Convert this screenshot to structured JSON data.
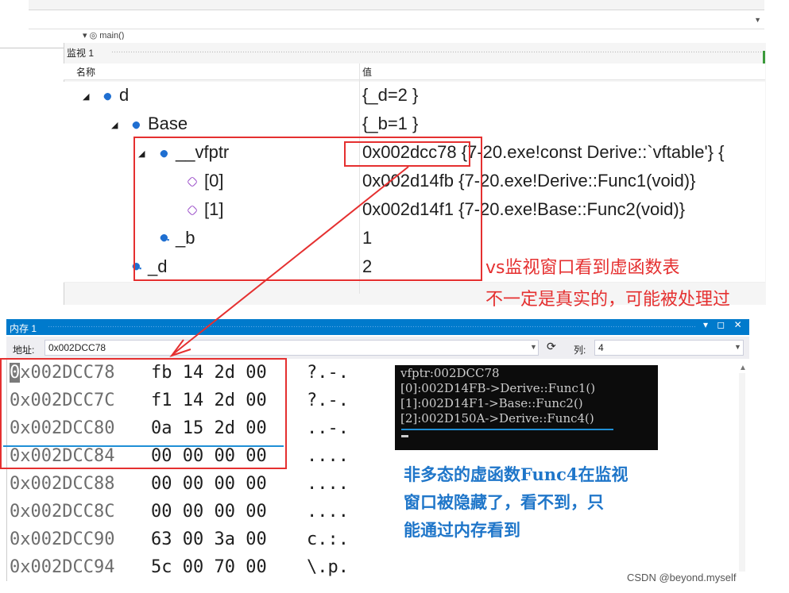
{
  "top": {
    "stack_frame": "main()"
  },
  "watch": {
    "title": "监视 1",
    "header": {
      "name": "名称",
      "value": "值"
    },
    "rows": [
      {
        "name": "d",
        "value": "{_d=2 }"
      },
      {
        "name": "Base",
        "value": "{_b=1 }"
      },
      {
        "name": "__vfptr",
        "value_addr": "0x002dcc78",
        "value_rest": " {7-20.exe!const Derive::`vftable'} {"
      },
      {
        "name": "[0]",
        "value": "0x002d14fb {7-20.exe!Derive::Func1(void)}"
      },
      {
        "name": "[1]",
        "value": "0x002d14f1 {7-20.exe!Base::Func2(void)}"
      },
      {
        "name": "_b",
        "value": "1"
      },
      {
        "name": "_d",
        "value": "2"
      }
    ]
  },
  "annotations": {
    "red_line1": "vs监视窗口看到虚函数表",
    "red_line2": "不一定是真实的，可能被处理过",
    "blue_lines": [
      "非多态的虚函数Func4在监视",
      "窗口被隐藏了，看不到，只",
      "能通过内存看到"
    ]
  },
  "memory": {
    "title": "内存 1",
    "window_buttons": "▾ ◻ ✕",
    "address_label": "地址:",
    "address_value": "0x002DCC78",
    "columns_label": "列:",
    "columns_value": "4",
    "rows": [
      {
        "addr_first": "0",
        "addr_rest": "x002DCC78",
        "bytes": "fb 14 2d 00",
        "ascii": "?.-."
      },
      {
        "addr": "0x002DCC7C",
        "bytes": "f1 14 2d 00",
        "ascii": "?.-."
      },
      {
        "addr": "0x002DCC80",
        "bytes": "0a 15 2d 00",
        "ascii": "..-."
      },
      {
        "addr": "0x002DCC84",
        "bytes": "00 00 00 00",
        "ascii": "...."
      },
      {
        "addr": "0x002DCC88",
        "bytes": "00 00 00 00",
        "ascii": "...."
      },
      {
        "addr": "0x002DCC8C",
        "bytes": "00 00 00 00",
        "ascii": "...."
      },
      {
        "addr": "0x002DCC90",
        "bytes": "63 00 3a 00",
        "ascii": "c.:."
      },
      {
        "addr": "0x002DCC94",
        "bytes": "5c 00 70 00",
        "ascii": "\\.p."
      }
    ]
  },
  "console": {
    "lines": [
      "vfptr:002DCC78",
      "[0]:002D14FB->Derive::Func1()",
      "[1]:002D14F1->Base::Func2()",
      "[2]:002D150A->Derive::Func4()"
    ]
  },
  "credit": "CSDN @beyond.myself",
  "colors": {
    "annotation_red": "#e53030",
    "annotation_blue": "#1f76c9",
    "vs_blue": "#007acc",
    "console_bg": "#0c0c0c"
  }
}
